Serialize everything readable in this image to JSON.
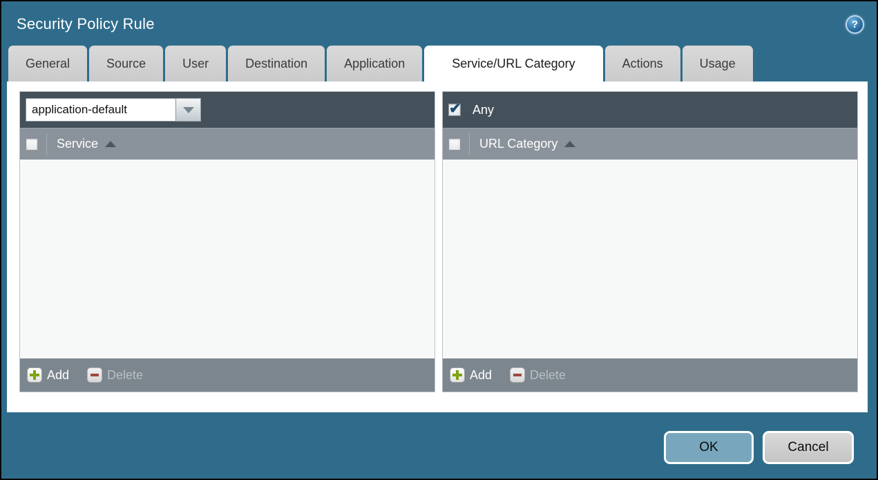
{
  "window": {
    "title": "Security Policy Rule",
    "help_icon_glyph": "?"
  },
  "tabs": [
    {
      "label": "General",
      "active": false
    },
    {
      "label": "Source",
      "active": false
    },
    {
      "label": "User",
      "active": false
    },
    {
      "label": "Destination",
      "active": false
    },
    {
      "label": "Application",
      "active": false
    },
    {
      "label": "Service/URL Category",
      "active": true
    },
    {
      "label": "Actions",
      "active": false
    },
    {
      "label": "Usage",
      "active": false
    }
  ],
  "active_tab": "Service/URL Category",
  "service_panel": {
    "dropdown": {
      "value": "application-default"
    },
    "column_header": "Service",
    "sort": "ascending",
    "rows": [],
    "add_label": "Add",
    "delete_label": "Delete",
    "delete_enabled": false
  },
  "url_category_panel": {
    "any_label": "Any",
    "any_checked": true,
    "column_header": "URL Category",
    "sort": "ascending",
    "rows": [],
    "add_label": "Add",
    "delete_label": "Delete",
    "delete_enabled": false
  },
  "actions": {
    "ok_label": "OK",
    "cancel_label": "Cancel"
  },
  "colors": {
    "background_teal": "#2f6c8b",
    "panel_header_dark": "#44505a",
    "column_header_gray": "#8a939b",
    "footer_gray": "#7c868e",
    "add_icon_green": "#7ea50e",
    "delete_icon_red": "#9d4a42",
    "ok_button_blue": "#78a7bd",
    "checkbox_check_blue": "#1c4a70",
    "active_tab_bg": "#ffffff",
    "inactive_tab_bg": "#d2d2d2"
  }
}
